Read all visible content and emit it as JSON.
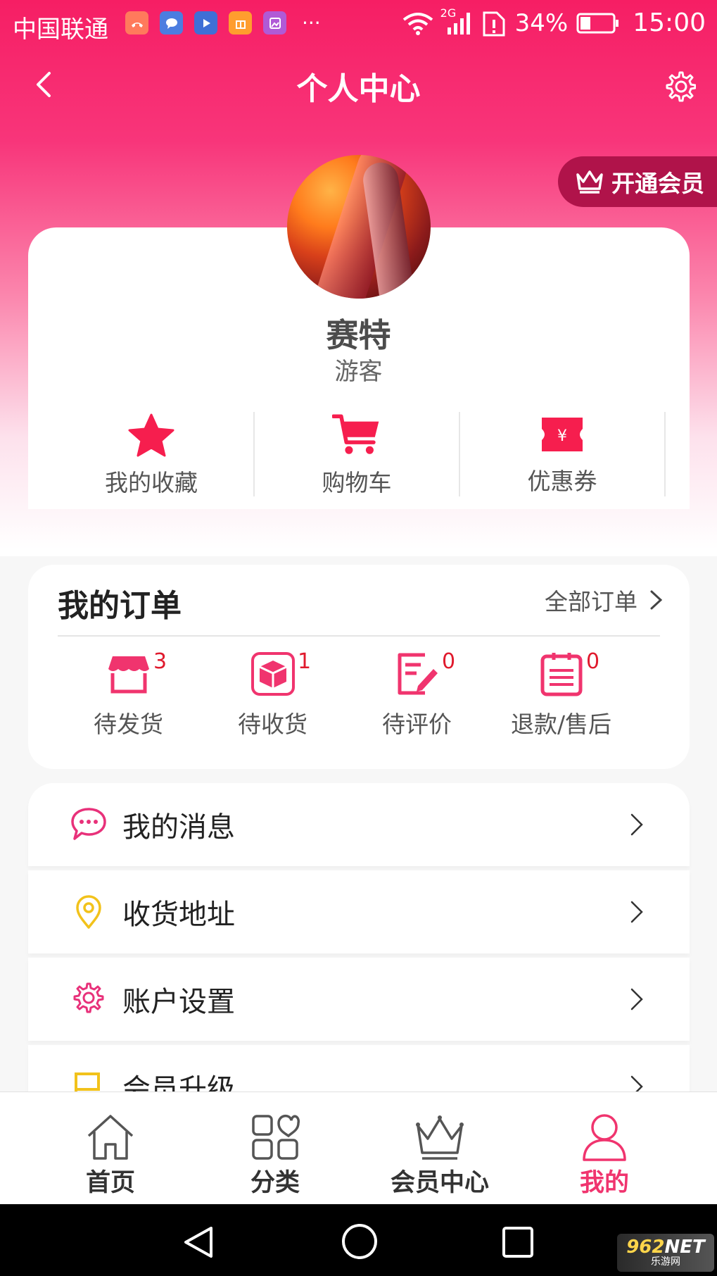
{
  "status_bar": {
    "carrier": "中国联通",
    "network": "2G",
    "battery": "34%",
    "time": "15:00",
    "more": "···",
    "app_icons": [
      "missed-call-icon",
      "message-icon",
      "video-icon",
      "gift-icon",
      "gallery-icon"
    ]
  },
  "header": {
    "title": "个人中心"
  },
  "vip": {
    "label": "开通会员"
  },
  "profile": {
    "name": "赛特",
    "role": "游客"
  },
  "quick_links": [
    {
      "label": "我的收藏",
      "icon": "star-icon"
    },
    {
      "label": "购物车",
      "icon": "cart-icon"
    },
    {
      "label": "优惠券",
      "icon": "coupon-icon"
    }
  ],
  "orders": {
    "title": "我的订单",
    "all_label": "全部订单",
    "items": [
      {
        "label": "待发货",
        "count": "3",
        "icon": "shop-icon"
      },
      {
        "label": "待收货",
        "count": "1",
        "icon": "package-icon"
      },
      {
        "label": "待评价",
        "count": "0",
        "icon": "edit-note-icon"
      },
      {
        "label": "退款/售后",
        "count": "0",
        "icon": "list-icon"
      }
    ]
  },
  "menu": [
    {
      "label": "我的消息",
      "icon": "chat-bubble-icon"
    },
    {
      "label": "收货地址",
      "icon": "location-pin-icon"
    },
    {
      "label": "账户设置",
      "icon": "gear-icon"
    },
    {
      "label": "会员升级",
      "icon": "flag-icon"
    }
  ],
  "tabbar": [
    {
      "label": "首页",
      "icon": "home-icon"
    },
    {
      "label": "分类",
      "icon": "category-icon"
    },
    {
      "label": "会员中心",
      "icon": "crown-icon"
    },
    {
      "label": "我的",
      "icon": "user-icon",
      "active": true
    }
  ],
  "watermark": {
    "top": "962",
    "top_suffix": "NET",
    "bottom": "乐游网"
  },
  "colors": {
    "brand": "#f61e64",
    "accent": "#f0346e",
    "badge": "#e01a2d",
    "vip_bg": "#b0134a",
    "address_icon": "#f2c21b",
    "flag_icon": "#f2c21b"
  }
}
